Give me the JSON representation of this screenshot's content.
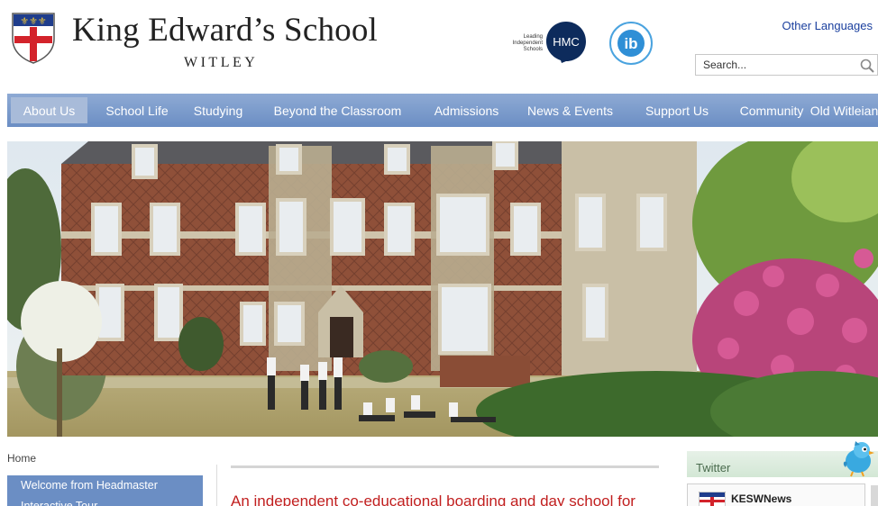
{
  "header": {
    "school_name": "King Edward’s School",
    "school_location": "WITLEY",
    "hmc_text": "Leading Independent Schools",
    "hmc_abbr": "HMC",
    "ib_abbr": "ib",
    "other_languages": "Other Languages",
    "search_placeholder": "Search..."
  },
  "nav": {
    "items": [
      {
        "label": "About Us"
      },
      {
        "label": "School Life"
      },
      {
        "label": "Studying"
      },
      {
        "label": "Beyond the Classroom"
      },
      {
        "label": "Admissions"
      },
      {
        "label": "News & Events"
      },
      {
        "label": "Support Us"
      },
      {
        "label": "Community"
      },
      {
        "label": "Old Witleians"
      }
    ],
    "active_index": 0
  },
  "breadcrumb": "Home",
  "left_nav": {
    "items": [
      {
        "label": "Welcome from Headmaster"
      },
      {
        "label": "Interactive Tour"
      }
    ]
  },
  "main": {
    "intro": "An independent co-educational boarding and day school for"
  },
  "twitter": {
    "heading": "Twitter",
    "user": "KESWNews"
  },
  "colors": {
    "nav_bg": "#7a9acb",
    "nav_active": "#a8bbd9",
    "intro_red": "#c11f1f",
    "link_blue": "#1a3f9e",
    "twitter_green": "#d3e7d5"
  }
}
